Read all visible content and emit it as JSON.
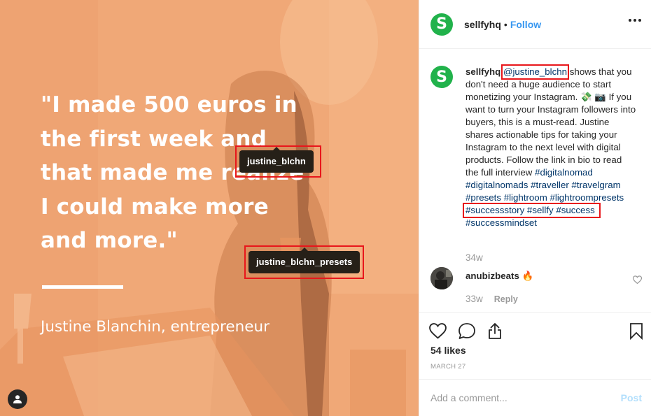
{
  "image": {
    "quote": "\"I made 500 euros in the first week and that made me realize I could make more and more.\"",
    "attribution": "Justine Blanchin, entrepreneur",
    "tags": [
      "justine_blchn",
      "justine_blchn_presets"
    ],
    "overlay_color": "#f0a877"
  },
  "header": {
    "logo_letter": "S",
    "username": "sellfyhq",
    "separator": "•",
    "follow_label": "Follow",
    "brand_color": "#21b24b"
  },
  "caption": {
    "username": "sellfyhq",
    "mention": "@justine_blchn",
    "text_1": " shows that you don't need a huge audience to start monetizing your Instagram. 💸 📷 If you want to turn your Instagram followers into buyers, this is a must-read. Justine shares actionable tips for taking your Instagram to the next level with digital products. Follow the link in bio to read the full interview ",
    "hashtags_1": "#digitalnomad #digitalnomads #traveller #travelgram #presets #lightroom #lightroompresets",
    "hashtags_2": "#successstory #sellfy #success",
    "hashtags_3": "#successmindset",
    "time": "34w"
  },
  "reply": {
    "username": "anubizbeats",
    "text": "🔥",
    "time": "33w",
    "reply_label": "Reply"
  },
  "actions": {
    "likes": "54 likes",
    "date": "MARCH 27"
  },
  "add_comment": {
    "placeholder": "Add a comment...",
    "post_label": "Post"
  }
}
